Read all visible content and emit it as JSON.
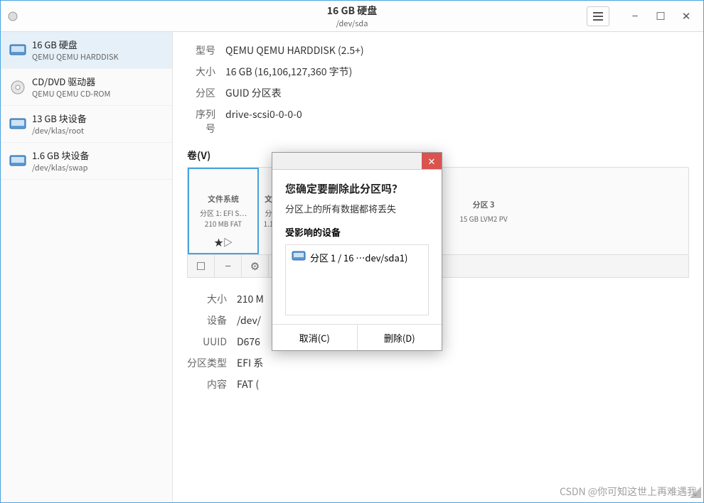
{
  "titlebar": {
    "title": "16 GB 硬盘",
    "subtitle": "/dev/sda",
    "menu_icon": "menu"
  },
  "sidebar": {
    "devices": [
      {
        "name": "16 GB 硬盘",
        "sub": "QEMU QEMU HARDDISK",
        "icon": "hdd",
        "active": true
      },
      {
        "name": "CD/DVD 驱动器",
        "sub": "QEMU QEMU CD-ROM",
        "icon": "cd",
        "active": false
      },
      {
        "name": "13 GB 块设备",
        "sub": "/dev/klas/root",
        "icon": "hdd",
        "active": false
      },
      {
        "name": "1.6 GB 块设备",
        "sub": "/dev/klas/swap",
        "icon": "hdd",
        "active": false
      }
    ]
  },
  "info": {
    "model_label": "型号",
    "model_value": "QEMU QEMU HARDDISK (2.5+)",
    "size_label": "大小",
    "size_value": "16 GB (16,106,127,360 字节)",
    "part_label": "分区",
    "part_value": "GUID 分区表",
    "serial_label": "序列号",
    "serial_value": "drive-scsi0-0-0-0"
  },
  "volumes_section": "卷(V)",
  "volumes": [
    {
      "head": "文件系统",
      "l2": "分区 1: EFI S…",
      "l3": "210 MB FAT",
      "star": "★▷",
      "flex": "0 0 100px",
      "selected": true
    },
    {
      "head": "文",
      "l2": "分",
      "l3": "1.1",
      "star": "",
      "flex": "0 0 24px",
      "selected": false
    },
    {
      "head": "分区 3",
      "l2": "15 GB LVM2 PV",
      "l3": "",
      "star": "",
      "flex": "1",
      "selected": false
    }
  ],
  "toolbar_icons": [
    "☐",
    "−",
    "⚙",
    "▷"
  ],
  "detail": {
    "rows": [
      {
        "lbl": "大小",
        "val": "210 M"
      },
      {
        "lbl": "设备",
        "val": "/dev/"
      },
      {
        "lbl": "UUID",
        "val": "D676"
      },
      {
        "lbl": "分区类型",
        "val": "EFI 系"
      },
      {
        "lbl": "内容",
        "val": "FAT ("
      }
    ]
  },
  "dialog": {
    "title": "您确定要删除此分区吗？",
    "message": "分区上的所有数据都将丢失",
    "affected_label": "受影响的设备",
    "affected_item": "分区 1 / 16 …dev/sda1)",
    "cancel": "取消(C)",
    "delete": "删除(D)"
  },
  "watermark": "CSDN @你可知这世上再难遇我"
}
